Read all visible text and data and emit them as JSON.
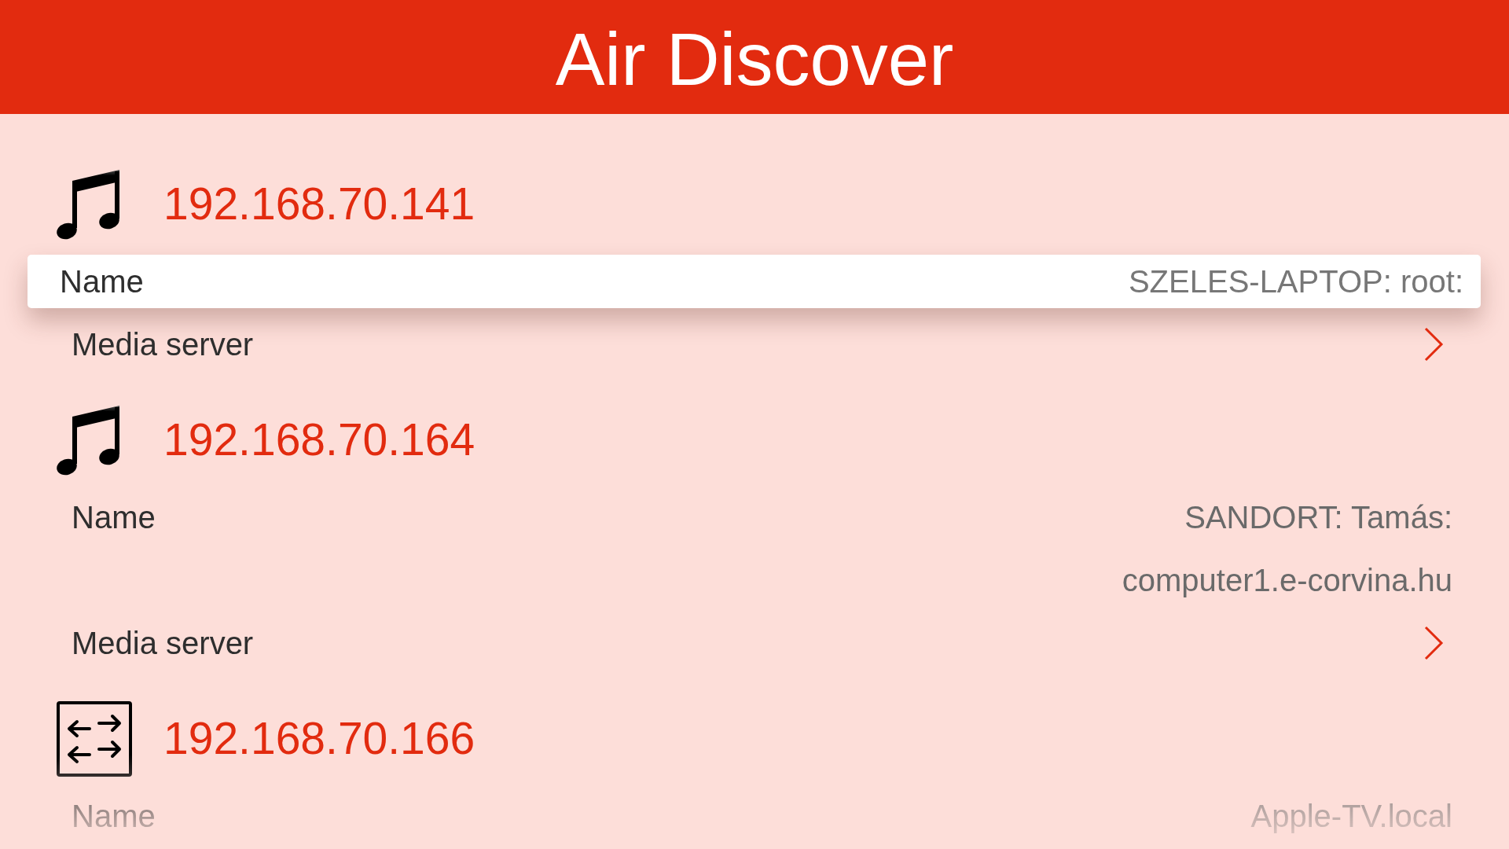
{
  "header": {
    "title": "Air Discover"
  },
  "list": [
    {
      "kind": "media",
      "ip": "192.168.70.141"
    },
    {
      "kind": "field",
      "label": "Name",
      "values": [
        "SZELES-LAPTOP: root:"
      ],
      "selected": true
    },
    {
      "kind": "link",
      "label": "Media server",
      "selected": false
    },
    {
      "kind": "media",
      "ip": "192.168.70.164"
    },
    {
      "kind": "field",
      "label": "Name",
      "values": [
        "SANDORT: Tamás:",
        "computer1.e-corvina.hu"
      ],
      "selected": false
    },
    {
      "kind": "link",
      "label": "Media server",
      "selected": false
    },
    {
      "kind": "network",
      "ip": "192.168.70.166"
    },
    {
      "kind": "field",
      "label": "Name",
      "values": [
        "Apple-TV.local"
      ],
      "selected": false
    }
  ]
}
